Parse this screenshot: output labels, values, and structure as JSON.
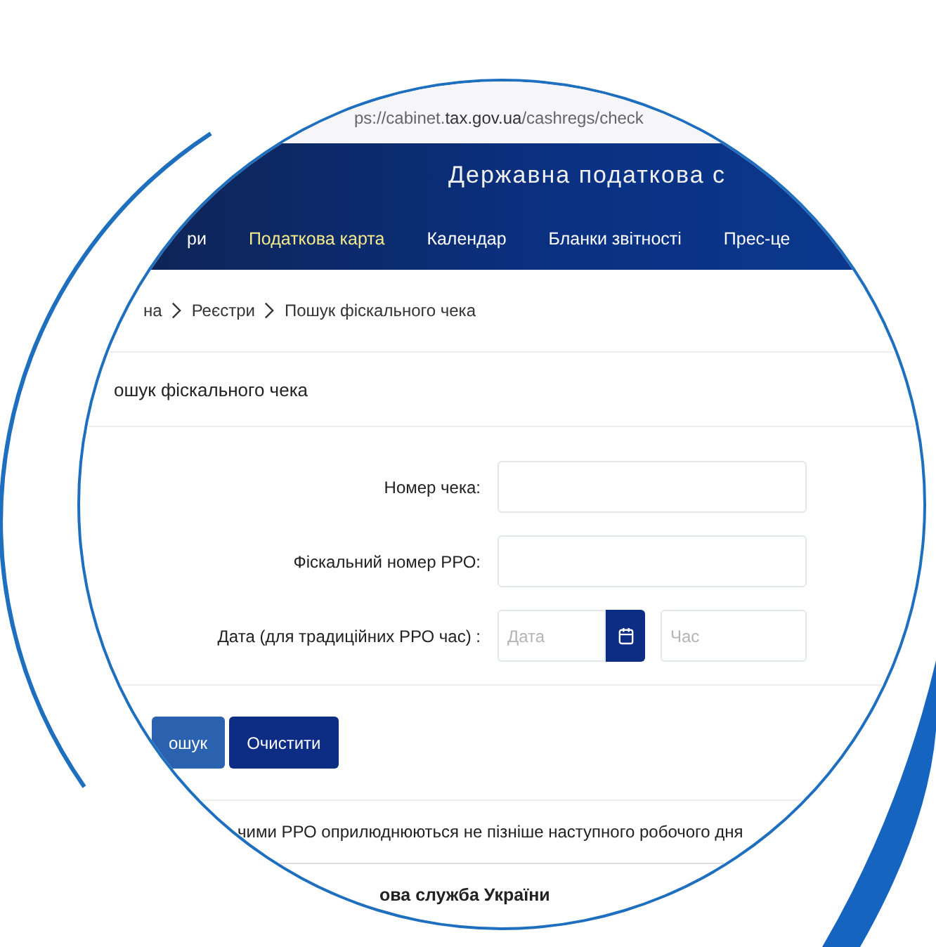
{
  "address_bar": {
    "url": "ps://cabinet.**tax.gov.ua**/cashregs/check"
  },
  "header": {
    "title": "Державна податкова с"
  },
  "nav": [
    {
      "label": "ри",
      "selected": false
    },
    {
      "label": "Податкова карта",
      "selected": true
    },
    {
      "label": "Календар",
      "selected": false
    },
    {
      "label": "Бланки звітності",
      "selected": false
    },
    {
      "label": "Прес-це",
      "selected": false
    }
  ],
  "breadcrumbs": [
    "на",
    "Реєстри",
    "Пошук фіскального чека"
  ],
  "page_title": "ошук фіскального чека",
  "form": {
    "fields": [
      {
        "kind": "text",
        "label": "Номер чека:"
      },
      {
        "kind": "text",
        "label": "Фіскальний номер РРО:"
      },
      {
        "kind": "datetime",
        "label": "Дата (для традиційних РРО час) :",
        "date_placeholder": "Дата",
        "time_placeholder": "Час"
      }
    ]
  },
  "buttons": [
    {
      "label": "ошук",
      "kind": "primary"
    },
    {
      "label": "Очистити",
      "kind": "secondary"
    }
  ],
  "notice": "чими РРО оприлюднюються не пізніше наступного робочого дня",
  "footer": {
    "text": "ова служба України"
  }
}
